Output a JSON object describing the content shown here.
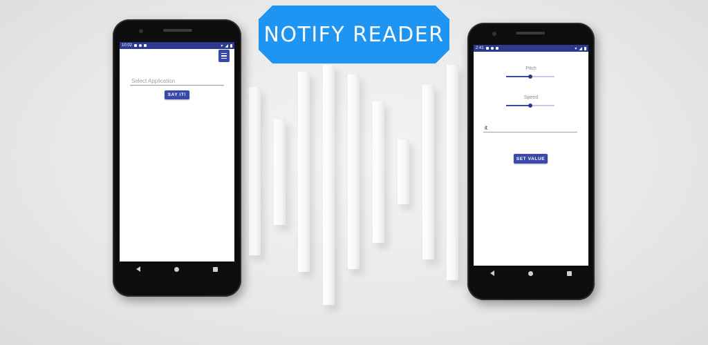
{
  "banner": {
    "title": "NOTIFY READER"
  },
  "phone_left": {
    "status": {
      "time": "10:02"
    },
    "search": {
      "placeholder": "Select Application"
    },
    "say_button": {
      "label": "SAY IT!"
    },
    "menu_icon": "hamburger-menu-icon"
  },
  "phone_right": {
    "status": {
      "time": "2:41"
    },
    "pitch": {
      "label": "Pitch",
      "level": 0.5
    },
    "speed": {
      "label": "Speed",
      "level": 0.5
    },
    "language_field": {
      "value": "it"
    },
    "set_button": {
      "label": "SET VALUE"
    }
  },
  "colors": {
    "accent": "#3949ab",
    "status_bar": "#2c3a8f",
    "banner": "#1e95f2"
  }
}
